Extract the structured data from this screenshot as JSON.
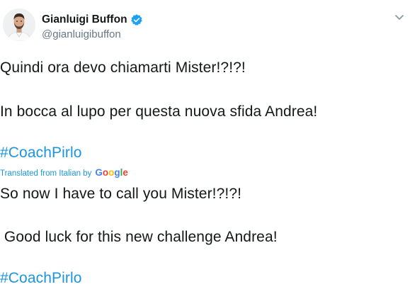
{
  "tweet": {
    "author": {
      "display_name": "Gianluigi Buffon",
      "handle": "@gianluigibuffon",
      "verified": true
    },
    "original": {
      "line1": "Quindi ora devo chiamarti Mister!?!?!",
      "line2": "In bocca al lupo per questa nuova sfida Andrea!",
      "hashtag": "#CoachPirlo"
    },
    "translation_note": {
      "label": "Translated from Italian by",
      "provider_letters": [
        "G",
        "o",
        "o",
        "g",
        "l",
        "e"
      ]
    },
    "translated": {
      "line1": "So now I have to call you Mister!?!?!",
      "line2": " Good luck for this new challenge Andrea!",
      "hashtag": "#CoachPirlo"
    }
  },
  "colors": {
    "hashtag": "#1b95e0",
    "handle": "#657786",
    "verified_badge": "#1da1f2",
    "text": "#14171a"
  },
  "icons": {
    "verified": "verified-badge-icon",
    "more": "chevron-down-icon"
  }
}
